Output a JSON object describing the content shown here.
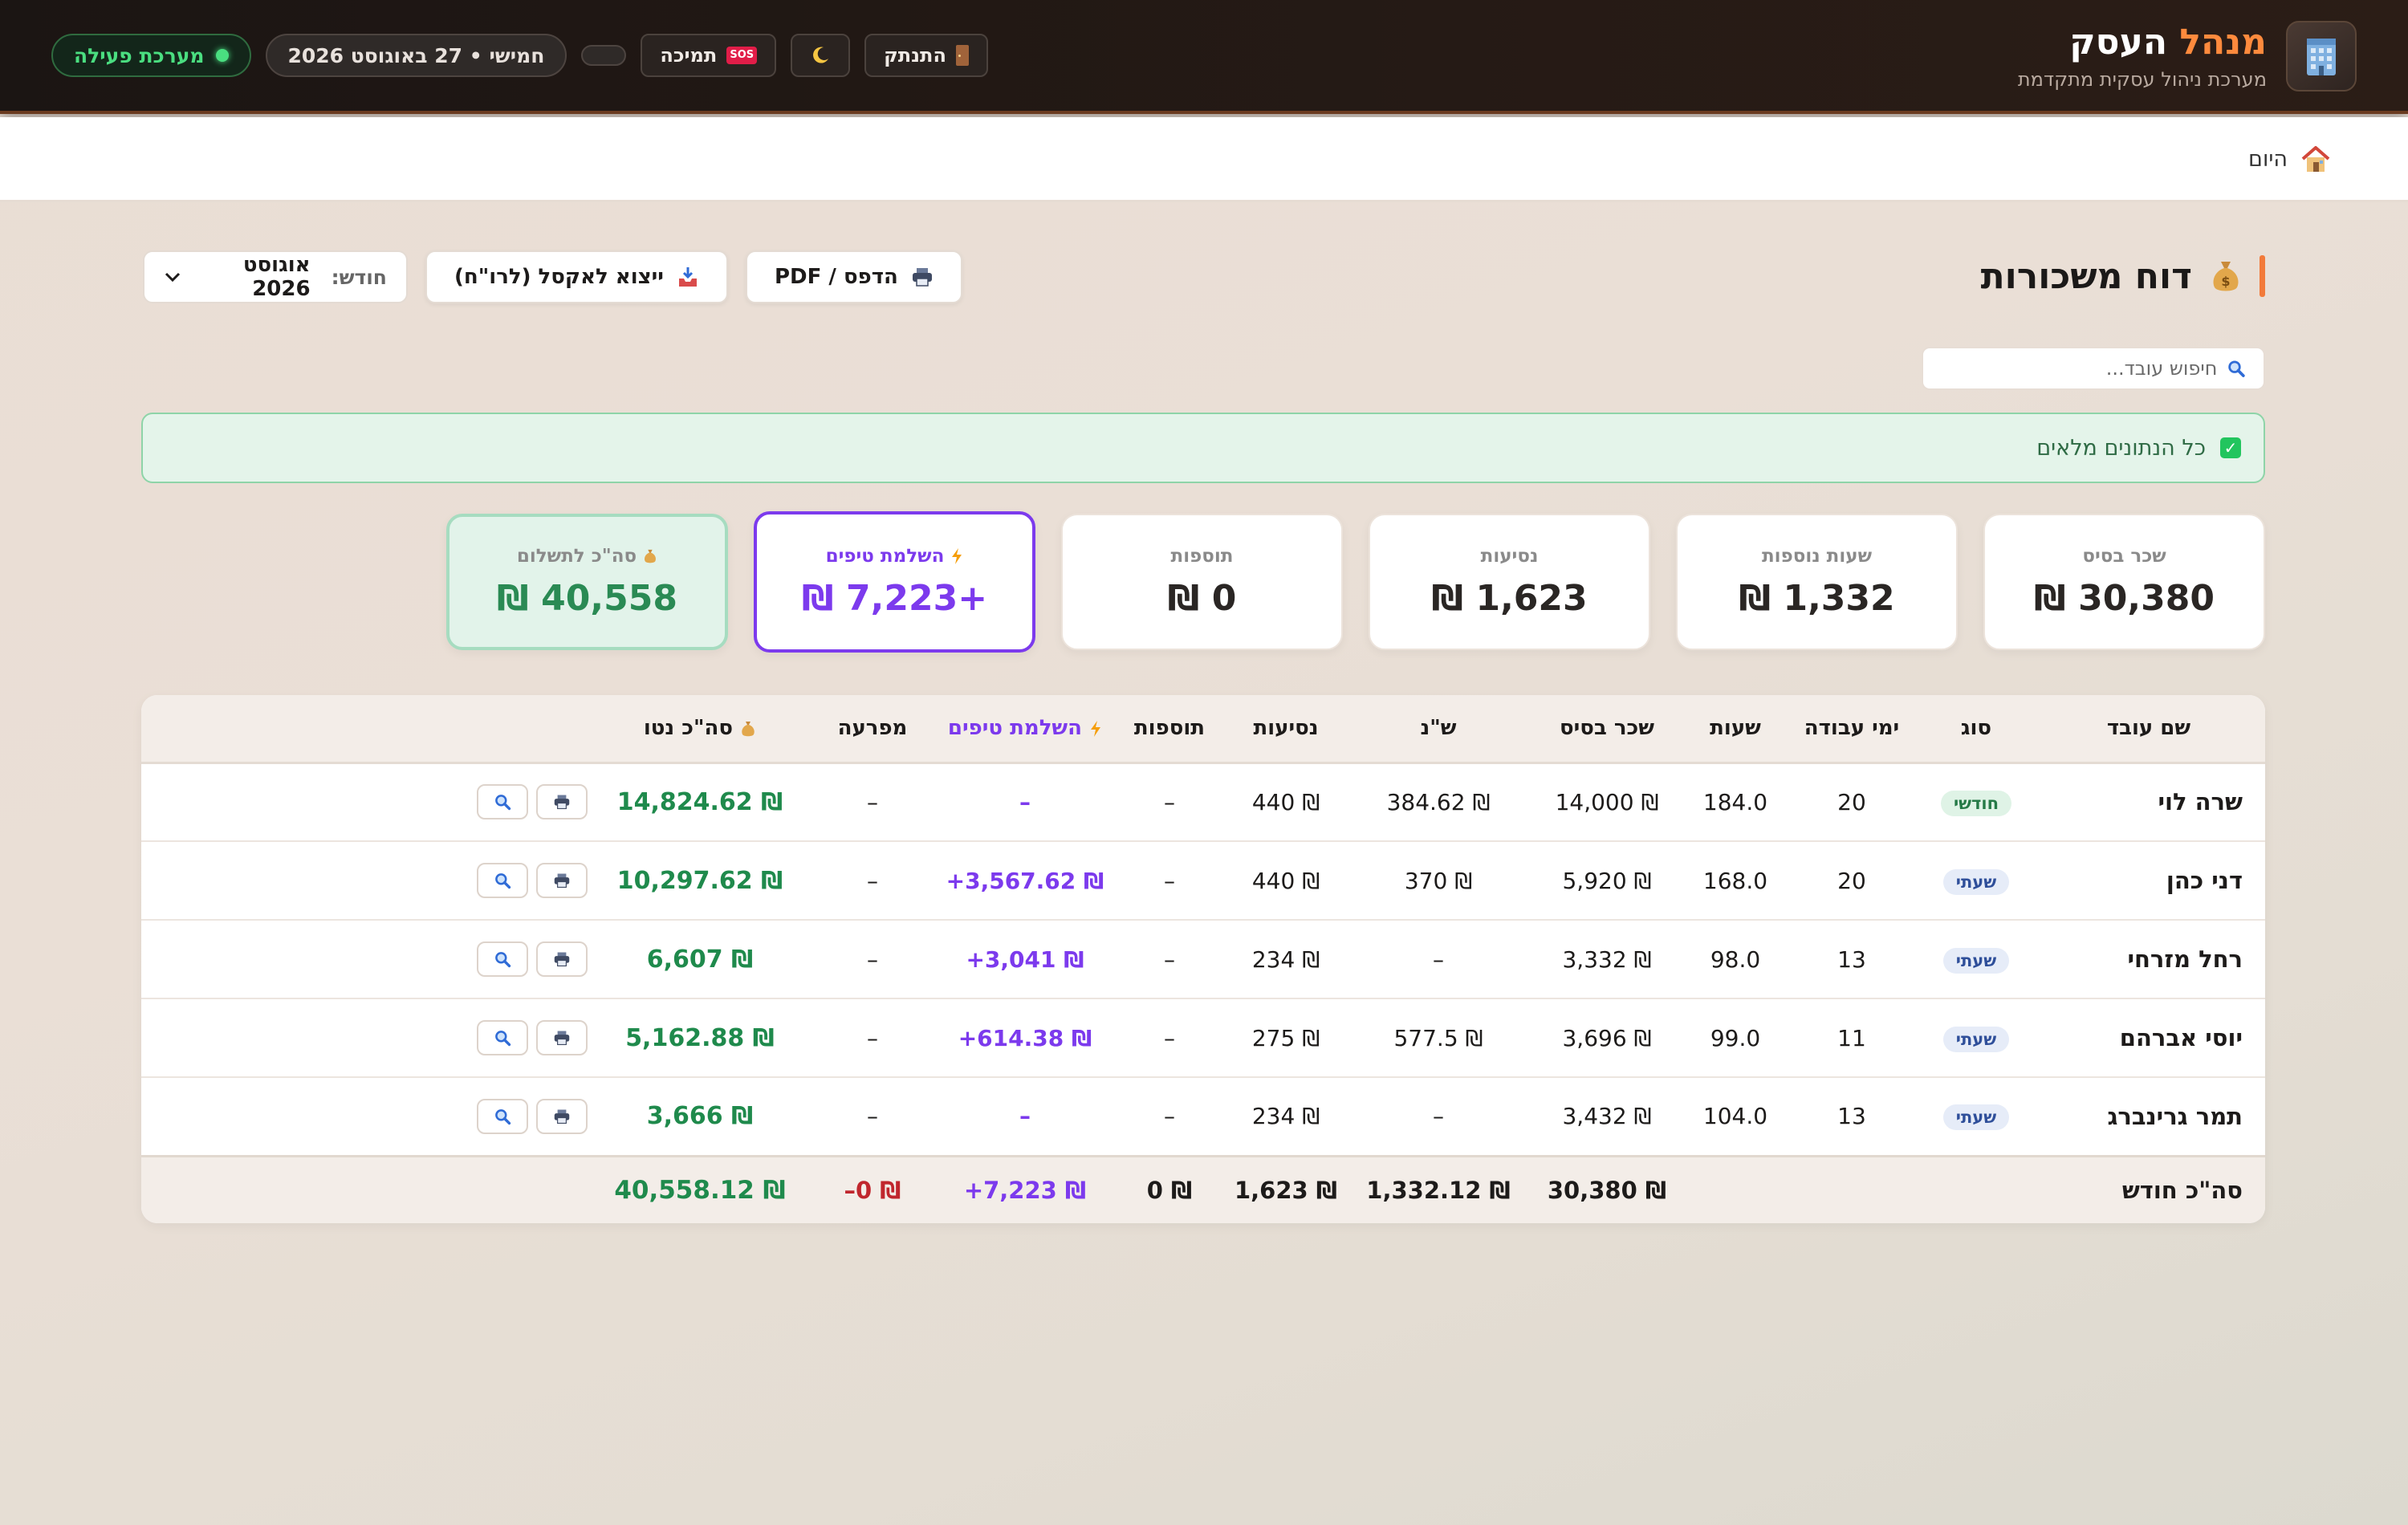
{
  "header": {
    "brand_title_accent": "מנהל",
    "brand_title_main": "העסק",
    "brand_subtitle": "מערכת ניהול עסקית מתקדמת",
    "status": "מערכת פעילה",
    "date": "חמישי • 27 באוגוסט 2026",
    "support_label": "תמיכה",
    "logout_label": "התנתק",
    "icons": {
      "logo": "building-icon",
      "theme": "moon-icon",
      "support": "sos-icon",
      "logout": "door-icon"
    }
  },
  "breadcrumb": {
    "label": "היום",
    "icon": "home-icon"
  },
  "page": {
    "title": "דוח משכורות",
    "title_icon": "money-bag-icon",
    "month_label": "חודש:",
    "month_value": "אוגוסט 2026",
    "export_excel": "ייצוא לאקסל (לרו\"ח)",
    "print_pdf": "הדפס / PDF",
    "search_placeholder": "חיפוש עובד...",
    "alert": "כל הנתונים מלאים"
  },
  "cards": [
    {
      "label": "שכר בסיס",
      "value": "30,380 ₪"
    },
    {
      "label": "שעות נוספות",
      "value": "1,332 ₪"
    },
    {
      "label": "נסיעות",
      "value": "1,623 ₪"
    },
    {
      "label": "תוספות",
      "value": "0 ₪"
    },
    {
      "label": "השלמת טיפים",
      "value": "+7,223 ₪"
    },
    {
      "label": "סה\"כ לתשלום",
      "value": "40,558 ₪"
    }
  ],
  "table": {
    "headers": {
      "name": "שם עובד",
      "type": "סוג",
      "days": "ימי עבודה",
      "hours": "שעות",
      "base": "שכר בסיס",
      "overtime": "ש\"נ",
      "travel": "נסיעות",
      "extras": "תוספות",
      "tips": "השלמת טיפים",
      "deduct": "מפרעה",
      "net": "סה\"כ נטו"
    },
    "rows": [
      {
        "name": "שרה לוי",
        "type": "חודשי",
        "type_kind": "monthly",
        "days": "20",
        "hours": "184.0",
        "base": "14,000 ₪",
        "overtime": "384.62 ₪",
        "travel": "440 ₪",
        "extras": "–",
        "tips": "–",
        "deduct": "–",
        "net": "14,824.62 ₪"
      },
      {
        "name": "דני כהן",
        "type": "שעתי",
        "type_kind": "hourly",
        "days": "20",
        "hours": "168.0",
        "base": "5,920 ₪",
        "overtime": "370 ₪",
        "travel": "440 ₪",
        "extras": "–",
        "tips": "+3,567.62 ₪",
        "deduct": "–",
        "net": "10,297.62 ₪"
      },
      {
        "name": "רחל מזרחי",
        "type": "שעתי",
        "type_kind": "hourly",
        "days": "13",
        "hours": "98.0",
        "base": "3,332 ₪",
        "overtime": "–",
        "travel": "234 ₪",
        "extras": "–",
        "tips": "+3,041 ₪",
        "deduct": "–",
        "net": "6,607 ₪"
      },
      {
        "name": "יוסי אברהם",
        "type": "שעתי",
        "type_kind": "hourly",
        "days": "11",
        "hours": "99.0",
        "base": "3,696 ₪",
        "overtime": "577.5 ₪",
        "travel": "275 ₪",
        "extras": "–",
        "tips": "+614.38 ₪",
        "deduct": "–",
        "net": "5,162.88 ₪"
      },
      {
        "name": "תמר גרינברג",
        "type": "שעתי",
        "type_kind": "hourly",
        "days": "13",
        "hours": "104.0",
        "base": "3,432 ₪",
        "overtime": "–",
        "travel": "234 ₪",
        "extras": "–",
        "tips": "–",
        "deduct": "–",
        "net": "3,666 ₪"
      }
    ],
    "footer": {
      "label": "סה\"כ חודש",
      "base": "30,380 ₪",
      "overtime": "1,332.12 ₪",
      "travel": "1,623 ₪",
      "extras": "0 ₪",
      "tips": "+7,223 ₪",
      "deduct": "–0 ₪",
      "net": "40,558.12 ₪"
    }
  },
  "colors": {
    "accent": "#f27a3a",
    "tips": "#7c3aed",
    "net": "#1f8a4c",
    "deduct": "#c0262d",
    "status": "#4ade80"
  }
}
